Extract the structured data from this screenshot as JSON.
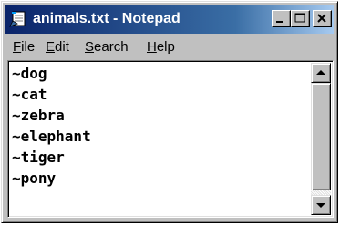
{
  "window": {
    "title": "animals.txt - Notepad",
    "app_icon": "notepad-icon",
    "controls": [
      "minimize-icon",
      "maximize-icon",
      "close-icon"
    ]
  },
  "menu": {
    "file": {
      "accel": "F",
      "rest": "ile"
    },
    "edit": {
      "accel": "E",
      "rest": "dit"
    },
    "search": {
      "accel": "S",
      "rest": "earch"
    },
    "help": {
      "accel": "H",
      "rest": "elp"
    }
  },
  "document": {
    "lines": [
      "~dog",
      "~cat",
      "~zebra",
      "~elephant",
      "~tiger",
      "~pony"
    ]
  },
  "scrollbar": {
    "up_icon": "arrow-up-icon",
    "down_icon": "arrow-down-icon"
  },
  "colors": {
    "title_active_start": "#0a246a",
    "title_active_end": "#a6caf0",
    "face": "#c0c0c0",
    "text": "#000000",
    "title_text": "#ffffff"
  }
}
